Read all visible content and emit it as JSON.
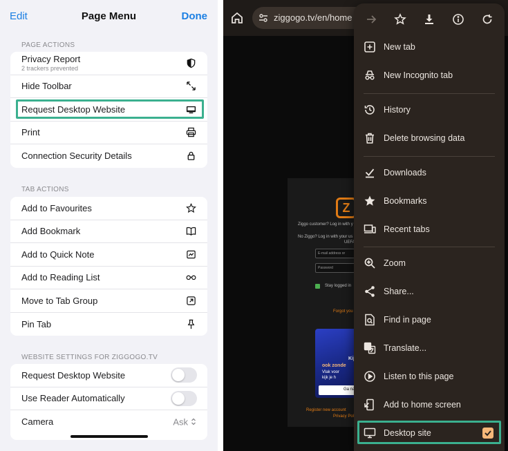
{
  "ios": {
    "nav": {
      "edit": "Edit",
      "title": "Page Menu",
      "done": "Done"
    },
    "page_actions": {
      "header": "PAGE ACTIONS",
      "items": [
        {
          "label": "Privacy Report",
          "sub": "2 trackers prevented",
          "icon": "shield-half-icon"
        },
        {
          "label": "Hide Toolbar",
          "icon": "expand-arrows-icon"
        },
        {
          "label": "Request Desktop Website",
          "icon": "desktop-icon"
        },
        {
          "label": "Print",
          "icon": "printer-icon"
        },
        {
          "label": "Connection Security Details",
          "icon": "lock-icon"
        }
      ]
    },
    "tab_actions": {
      "header": "TAB ACTIONS",
      "items": [
        {
          "label": "Add to Favourites",
          "icon": "star-icon"
        },
        {
          "label": "Add Bookmark",
          "icon": "book-icon"
        },
        {
          "label": "Add to Quick Note",
          "icon": "quick-note-icon"
        },
        {
          "label": "Add to Reading List",
          "icon": "glasses-icon"
        },
        {
          "label": "Move to Tab Group",
          "icon": "tab-group-icon"
        },
        {
          "label": "Pin Tab",
          "icon": "pin-icon"
        }
      ]
    },
    "website_settings": {
      "header": "WEBSITE SETTINGS FOR ZIGGOGO.TV",
      "items": [
        {
          "label": "Request Desktop Website",
          "toggle": false
        },
        {
          "label": "Use Reader Automatically",
          "toggle": false
        },
        {
          "label": "Camera",
          "value": "Ask"
        }
      ]
    },
    "highlight_color": "#3bb08f"
  },
  "chrome": {
    "url": "ziggogo.tv/en/home",
    "site": {
      "logo": "Z",
      "line1": "Ziggo customer? Log in with y",
      "line2": "No Ziggo? Log in with your us",
      "line3": "UEFA",
      "email_placeholder": "E-mail address or",
      "password_placeholder": "Password",
      "stay_logged": "Stay logged in",
      "forgot": "Forgot you",
      "banner1": "Kij",
      "banner2": "ook zonde",
      "banner3": "Vlak voor",
      "banner4": "kijk je h",
      "banner_btn": "Ga na",
      "footer1": "Register new account",
      "footer2": "Privacy Pol"
    },
    "menu": {
      "top_icons": [
        "forward-arrow-icon",
        "bookmark-star-icon",
        "download-icon",
        "info-icon",
        "refresh-icon"
      ],
      "items": [
        {
          "label": "New tab",
          "icon": "new-tab-icon"
        },
        {
          "label": "New Incognito tab",
          "icon": "incognito-icon"
        },
        {
          "label": "History",
          "icon": "history-icon"
        },
        {
          "label": "Delete browsing data",
          "icon": "trash-icon"
        },
        {
          "label": "Downloads",
          "icon": "downloads-icon"
        },
        {
          "label": "Bookmarks",
          "icon": "star-filled-icon"
        },
        {
          "label": "Recent tabs",
          "icon": "devices-icon"
        },
        {
          "label": "Zoom",
          "icon": "zoom-icon"
        },
        {
          "label": "Share...",
          "icon": "share-icon"
        },
        {
          "label": "Find in page",
          "icon": "find-icon"
        },
        {
          "label": "Translate...",
          "icon": "translate-icon"
        },
        {
          "label": "Listen to this page",
          "icon": "play-circle-icon"
        },
        {
          "label": "Add to home screen",
          "icon": "add-home-icon"
        },
        {
          "label": "Desktop site",
          "icon": "monitor-icon",
          "checked": true
        }
      ]
    },
    "accent": "#f5b779"
  }
}
